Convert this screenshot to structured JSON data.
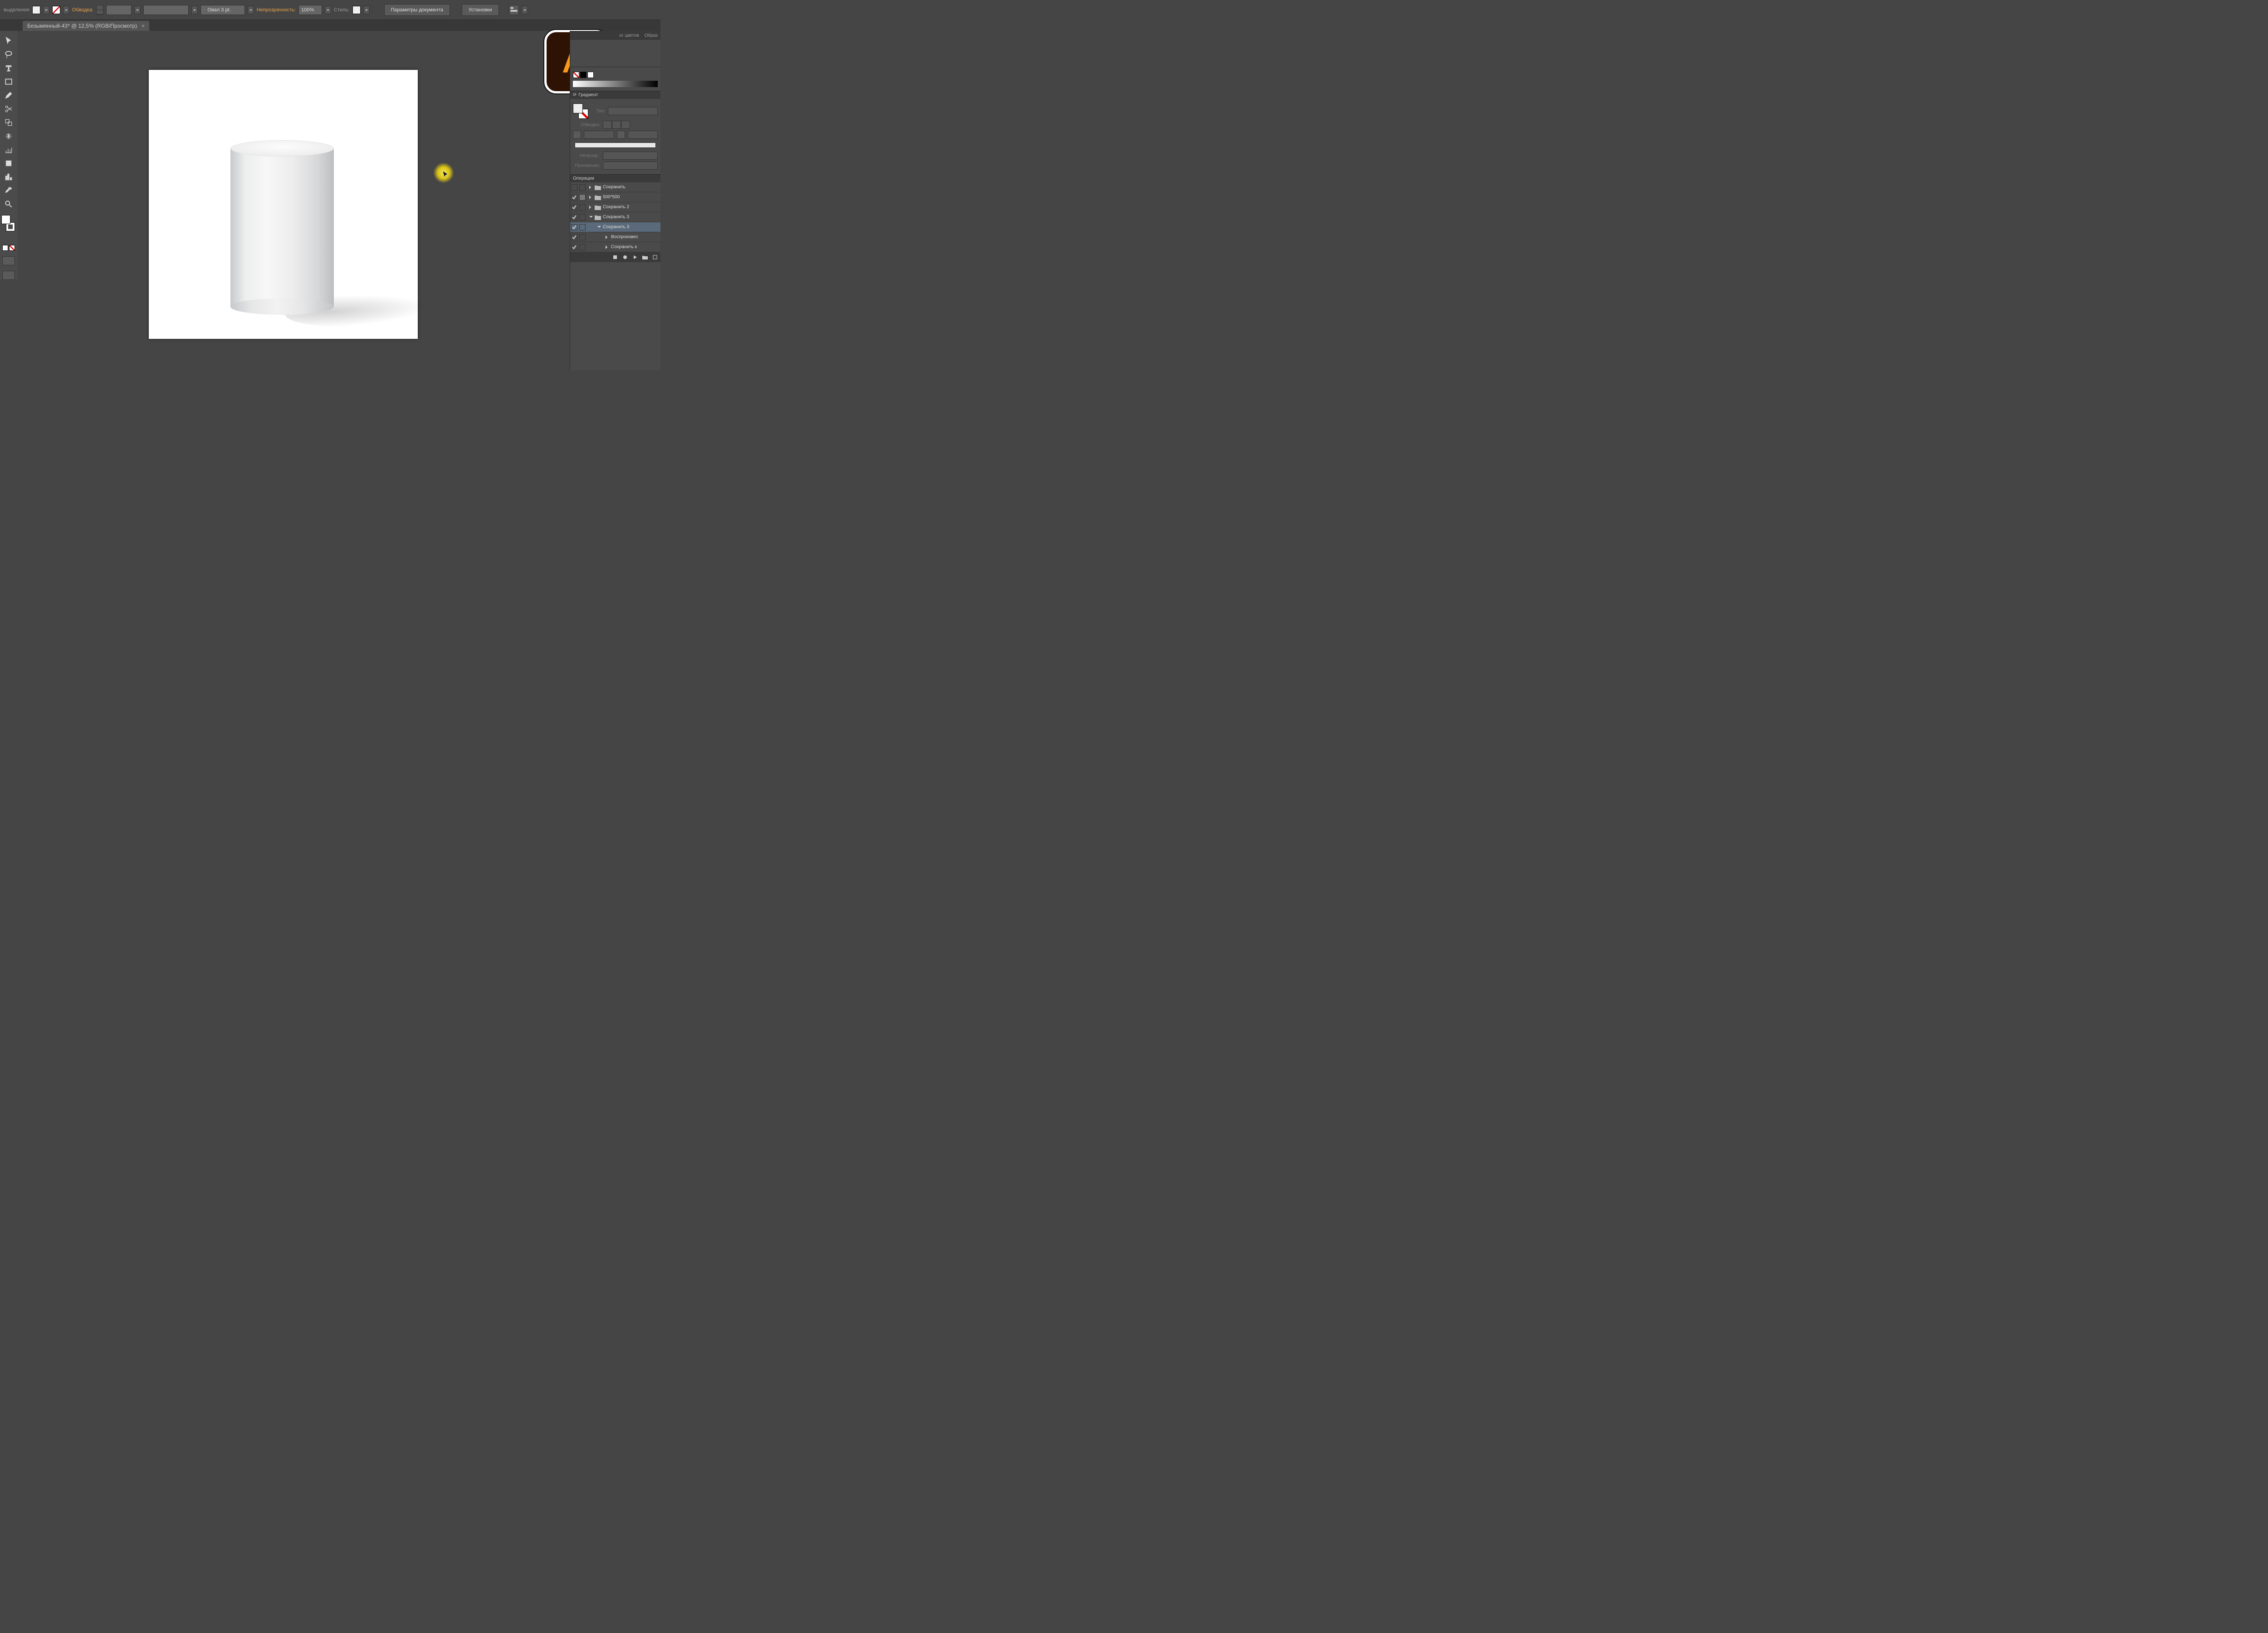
{
  "top": {
    "selection_label": "выделения",
    "stroke_label": "Обводка:",
    "brush_value": "Овал 3 pt.",
    "opacity_label": "Непрозрачность:",
    "opacity_value": "100%",
    "style_label": "Стиль:",
    "doc_params_btn": "Параметры документа",
    "settings_btn": "Установки"
  },
  "tab": {
    "title": "Безымянный-43* @ 12,5% (RGB/Просмотр)",
    "close": "×"
  },
  "right_tabs": {
    "colors_tab": "ог цветов",
    "samples_tab": "Образ"
  },
  "gradient": {
    "title": "Градиент",
    "type_label": "Тип:",
    "stroke_label": "Обводка:",
    "opacity_label": "Непрозр.:",
    "position_label": "Положение:"
  },
  "actions": {
    "title": "Операции",
    "rows": [
      {
        "label": "Сохранить",
        "expanded": false,
        "nesting": 0,
        "folder": true,
        "checked": false
      },
      {
        "label": "500*500",
        "expanded": false,
        "nesting": 0,
        "folder": true,
        "checked": true,
        "box": true
      },
      {
        "label": "Сохранить 2",
        "expanded": false,
        "nesting": 0,
        "folder": true,
        "checked": true
      },
      {
        "label": "Сохранить 3",
        "expanded": true,
        "nesting": 0,
        "folder": true,
        "checked": true
      },
      {
        "label": "Сохранить 3",
        "expanded": true,
        "nesting": 1,
        "folder": false,
        "checked": true,
        "selected": true
      },
      {
        "label": "Воспроизвес",
        "expanded": false,
        "nesting": 2,
        "folder": false,
        "checked": true
      },
      {
        "label": "Сохранить к",
        "expanded": false,
        "nesting": 2,
        "folder": false,
        "checked": true
      }
    ]
  },
  "logo": {
    "text": "Ai"
  }
}
